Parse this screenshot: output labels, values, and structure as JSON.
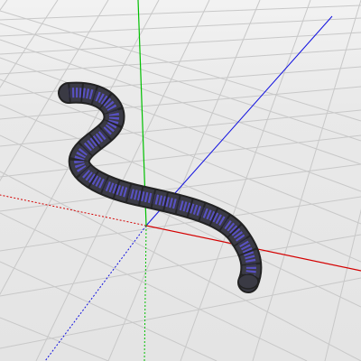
{
  "scene": {
    "background": "#ebebeb",
    "grid_color": "#c8c8c8",
    "axes": {
      "x_color": "#d40000",
      "y_color": "#00c000",
      "z_color": "#1010e0"
    },
    "object": {
      "type": "segmented-tube",
      "body_color": "#3a3a44",
      "segment_color": "#5a52c8",
      "outline_color": "#222222"
    }
  }
}
